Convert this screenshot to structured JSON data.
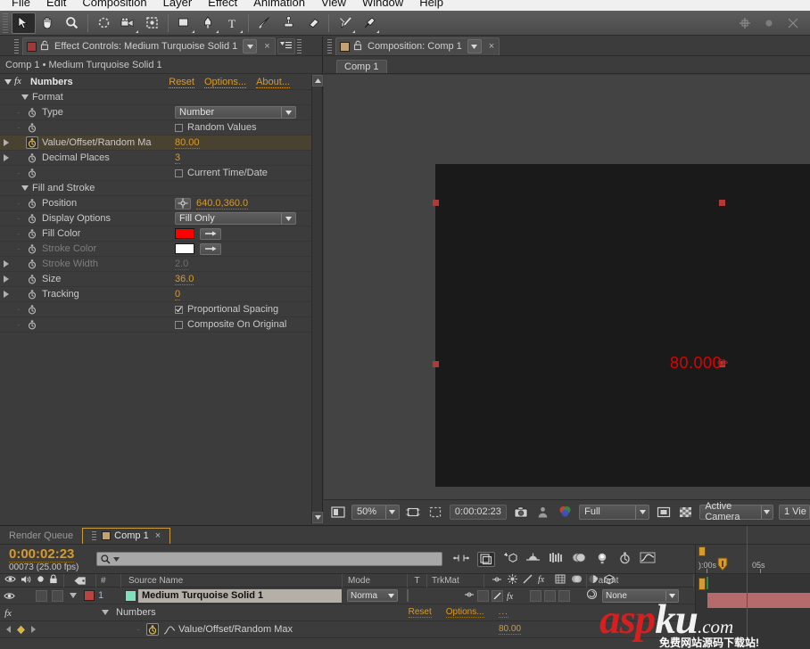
{
  "menu": {
    "items": [
      "File",
      "Edit",
      "Composition",
      "Layer",
      "Effect",
      "Animation",
      "View",
      "Window",
      "Help"
    ]
  },
  "toolbar": {
    "tools": [
      {
        "name": "selection-tool",
        "selected": true
      },
      {
        "name": "hand-tool",
        "selected": false
      },
      {
        "name": "zoom-tool",
        "selected": false
      },
      {
        "name": "rotation-tool",
        "selected": false
      },
      {
        "name": "camera-orbit-tool",
        "selected": false
      },
      {
        "name": "pan-behind-tool",
        "selected": false
      },
      {
        "name": "shape-tool",
        "selected": false
      },
      {
        "name": "pen-tool",
        "selected": false
      },
      {
        "name": "type-tool",
        "selected": false
      },
      {
        "name": "brush-tool",
        "selected": false
      },
      {
        "name": "clone-stamp-tool",
        "selected": false
      },
      {
        "name": "eraser-tool",
        "selected": false
      },
      {
        "name": "roto-brush-tool",
        "selected": false
      },
      {
        "name": "puppet-pin-tool",
        "selected": false
      }
    ]
  },
  "effect_controls": {
    "tab_title": "Effect Controls: Medium Turquoise Solid 1",
    "close_label": "×",
    "breadcrumb": "Comp 1 • Medium Turquoise Solid 1",
    "effect_name": "Numbers",
    "links": {
      "reset": "Reset",
      "options": "Options...",
      "about": "About..."
    },
    "groups": [
      {
        "name": "Format",
        "rows": [
          {
            "label": "Type",
            "type": "dropdown",
            "value": "Number"
          },
          {
            "label": "",
            "type": "checkbox",
            "value": "Random Values",
            "checked": false
          },
          {
            "label": "Value/Offset/Random Ma",
            "type": "value",
            "value": "80.00",
            "highlight": true,
            "expandable": true,
            "stopwatch_on": true
          },
          {
            "label": "Decimal Places",
            "type": "value",
            "value": "3",
            "expandable": true
          },
          {
            "label": "",
            "type": "checkbox",
            "value": "Current Time/Date",
            "checked": false
          }
        ]
      },
      {
        "name": "Fill and Stroke",
        "rows": [
          {
            "label": "Position",
            "type": "position",
            "value": "640.0,360.0"
          },
          {
            "label": "Display Options",
            "type": "dropdown",
            "value": "Fill Only"
          },
          {
            "label": "Fill Color",
            "type": "color",
            "color": "#ff0000"
          },
          {
            "label": "Stroke Color",
            "type": "color",
            "color": "#ffffff",
            "disabled": true
          },
          {
            "label": "Stroke Width",
            "type": "value",
            "value": "2.0",
            "disabled": true,
            "expandable": true
          },
          {
            "label": "Size",
            "type": "value",
            "value": "36.0",
            "expandable": true
          },
          {
            "label": "Tracking",
            "type": "value",
            "value": "0",
            "expandable": true
          },
          {
            "label": "",
            "type": "checkbox",
            "value": "Proportional Spacing",
            "checked": true
          },
          {
            "label": "",
            "type": "checkbox",
            "value": "Composite On Original",
            "checked": false
          }
        ]
      }
    ]
  },
  "composition": {
    "tab_title": "Composition: Comp 1",
    "close_label": "×",
    "sub_tab": "Comp 1",
    "canvas_text": "80.000",
    "text_color": "#ff0000",
    "viewer_bar": {
      "zoom": "50%",
      "time": "0:00:02:23",
      "resolution": "Full",
      "camera": "Active Camera",
      "views": "1 Vie"
    }
  },
  "timeline": {
    "tabs": [
      {
        "label": "Render Queue",
        "active": false
      },
      {
        "label": "Comp 1",
        "active": true
      }
    ],
    "timecode": "0:00:02:23",
    "framecode": "00073 (25.00 fps)",
    "search_placeholder": "",
    "columns": {
      "num": "#",
      "source_name": "Source Name",
      "mode": "Mode",
      "t": "T",
      "trkmat": "TrkMat",
      "parent": "Parent"
    },
    "layers": [
      {
        "index": "1",
        "name": "Medium Turquoise Solid 1",
        "label_color": "#7fe0bd",
        "mode": "Norma",
        "parent": "None",
        "effect": {
          "name": "Numbers",
          "reset": "Reset",
          "options": "Options...",
          "more": "...",
          "property": "Value/Offset/Random Max",
          "property_value": "80.00"
        }
      }
    ],
    "ruler_labels": [
      "):00s",
      "05s"
    ]
  },
  "watermark": {
    "asp": "asp",
    "ku": "ku",
    "com": ".com",
    "cn": "免费网站源码下载站!"
  },
  "colors": {
    "accent_orange": "#d89a2a",
    "panel_bg": "#3c3c3c",
    "playhead_red": "#e01b1b",
    "solid_label": "#7fe0bd"
  }
}
